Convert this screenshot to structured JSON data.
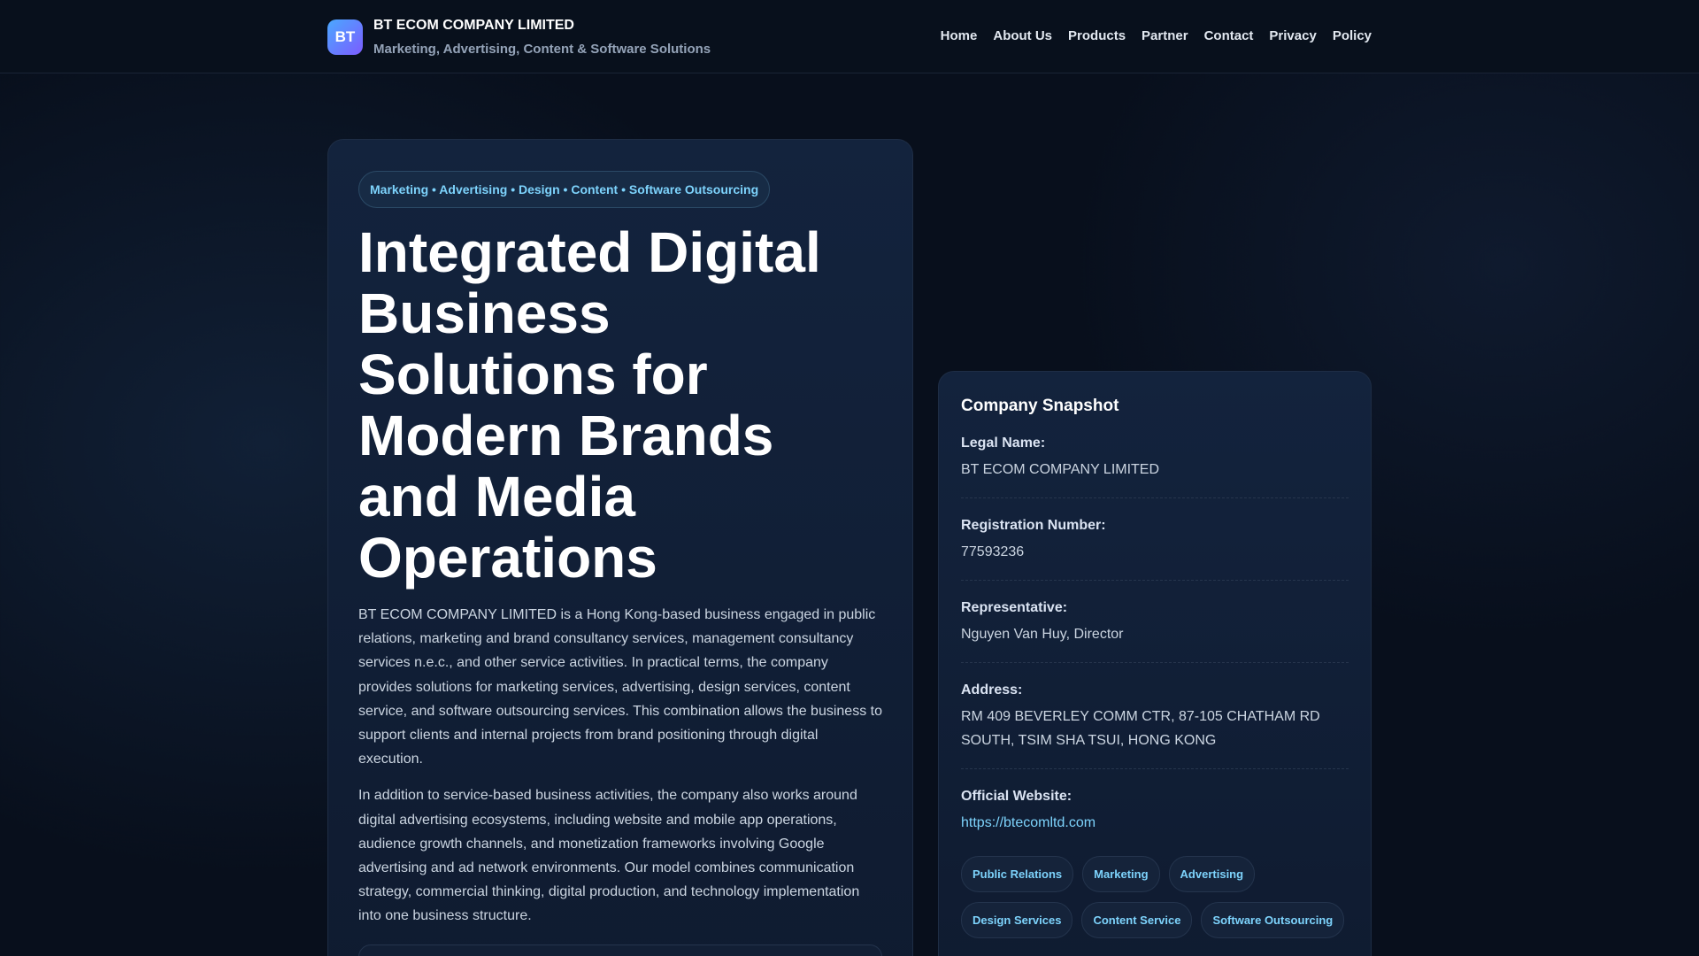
{
  "header": {
    "logo": "BT",
    "title": "BT ECOM COMPANY LIMITED",
    "subtitle": "Marketing, Advertising, Content & Software Solutions",
    "nav": [
      "Home",
      "About Us",
      "Products",
      "Partner",
      "Contact",
      "Privacy",
      "Policy"
    ]
  },
  "hero": {
    "badge": "Marketing • Advertising • Design • Content • Software Outsourcing",
    "title": "Integrated Digital Business Solutions for Modern Brands and Media Operations",
    "paragraphs": [
      "BT ECOM COMPANY LIMITED is a Hong Kong-based business engaged in public relations, marketing and brand consultancy services, management consultancy services n.e.c., and other service activities. In practical terms, the company provides solutions for marketing services, advertising, design services, content service, and software outsourcing services. This combination allows the business to support clients and internal projects from brand positioning through digital execution.",
      "In addition to service-based business activities, the company also works around digital advertising ecosystems, including website and mobile app operations, audience growth channels, and monetization frameworks involving Google advertising and ad network environments. Our model combines communication strategy, commercial thinking, digital production, and technology implementation into one business structure."
    ]
  },
  "snapshot": {
    "title": "Company Snapshot",
    "rows": [
      {
        "label": "Legal Name:",
        "value": "BT ECOM COMPANY LIMITED"
      },
      {
        "label": "Registration Number:",
        "value": "77593236"
      },
      {
        "label": "Representative:",
        "value": "Nguyen Van Huy, Director"
      },
      {
        "label": "Address:",
        "value": "RM 409 BEVERLEY COMM CTR, 87-105 CHATHAM RD SOUTH, TSIM SHA TSUI, HONG KONG"
      },
      {
        "label": "Official Website:",
        "value": "https://btecomltd.com"
      }
    ],
    "tags": [
      "Public Relations",
      "Marketing",
      "Advertising",
      "Design Services",
      "Content Service",
      "Software Outsourcing"
    ]
  }
}
